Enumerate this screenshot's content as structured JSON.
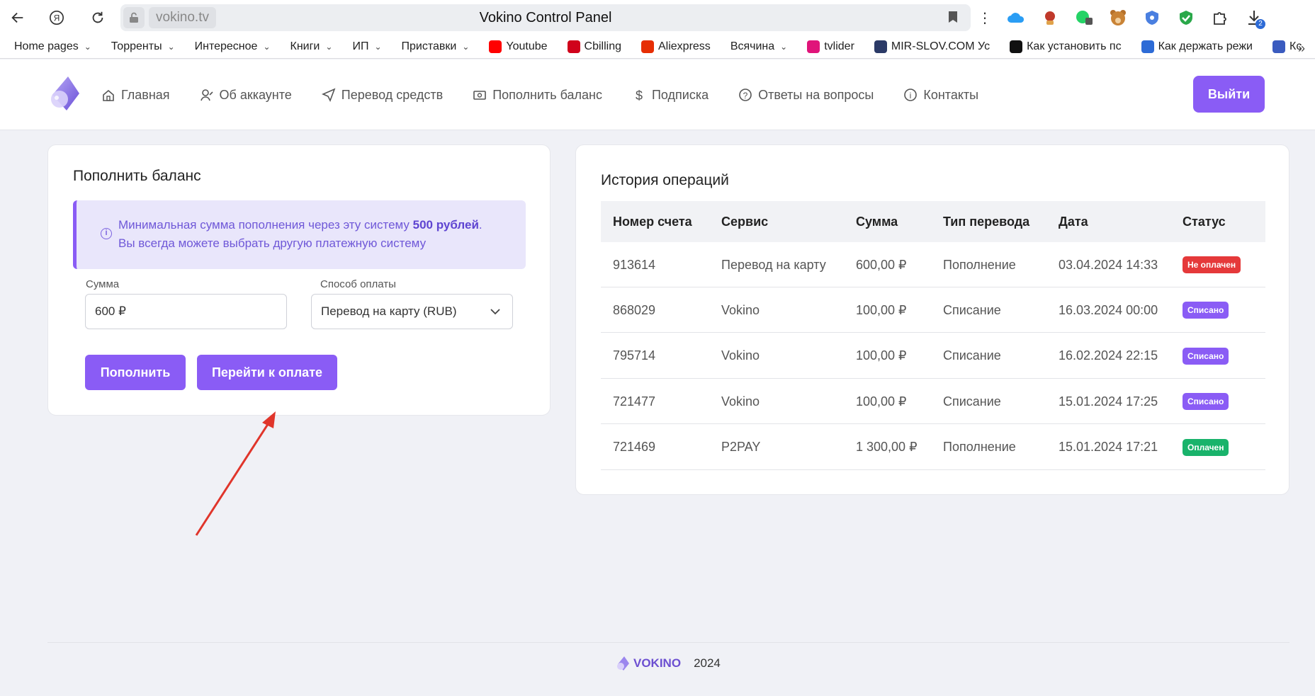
{
  "browser": {
    "domain": "vokino.tv",
    "tab_title": "Vokino Control Panel",
    "download_count": "2"
  },
  "bookmarks": [
    {
      "label": "Home pages",
      "dropdown": true
    },
    {
      "label": "Торренты",
      "dropdown": true
    },
    {
      "label": "Интересное",
      "dropdown": true
    },
    {
      "label": "Книги",
      "dropdown": true
    },
    {
      "label": "ИП",
      "dropdown": true
    },
    {
      "label": "Приставки",
      "dropdown": true
    },
    {
      "label": "Youtube",
      "icon": "youtube-icon",
      "color": "#ff0000"
    },
    {
      "label": "Cbilling",
      "icon": "cbilling-icon",
      "color": "#d0021b"
    },
    {
      "label": "Aliexpress",
      "icon": "aliexpress-icon",
      "color": "#e62e04"
    },
    {
      "label": "Всячина",
      "dropdown": true
    },
    {
      "label": "tvlider",
      "icon": "tvlider-icon",
      "color": "#e0147a"
    },
    {
      "label": "MIR-SLOV.COM Ус",
      "icon": "mirslov-icon",
      "color": "#2b3a67"
    },
    {
      "label": "Как установить пс",
      "icon": "openai-icon",
      "color": "#111111"
    },
    {
      "label": "Как держать режи",
      "icon": "ip-icon",
      "color": "#2d6bd6"
    },
    {
      "label": "Кс",
      "icon": "ks-icon",
      "color": "#3a5bbf"
    }
  ],
  "nav": {
    "items": [
      {
        "label": "Главная",
        "icon": "home-icon"
      },
      {
        "label": "Об аккаунте",
        "icon": "user-icon"
      },
      {
        "label": "Перевод средств",
        "icon": "send-icon"
      },
      {
        "label": "Пополнить баланс",
        "icon": "cash-icon"
      },
      {
        "label": "Подписка",
        "icon": "dollar-icon"
      },
      {
        "label": "Ответы на вопросы",
        "icon": "question-icon"
      },
      {
        "label": "Контакты",
        "icon": "info-icon"
      }
    ],
    "logout_label": "Выйти"
  },
  "topup": {
    "title": "Пополнить баланс",
    "alert_line1_prefix": "Минимальная сумма пополнения через эту систему ",
    "alert_line1_bold": "500 рублей",
    "alert_line1_suffix": ".",
    "alert_line2": "Вы всегда можете выбрать другую платежную систему",
    "amount_label": "Сумма",
    "amount_value": "600 ₽",
    "method_label": "Способ оплаты",
    "method_value": "Перевод на карту (RUB)",
    "topup_button": "Пополнить",
    "pay_button": "Перейти к оплате"
  },
  "history": {
    "title": "История операций",
    "columns": [
      "Номер счета",
      "Сервис",
      "Сумма",
      "Тип перевода",
      "Дата",
      "Статус"
    ],
    "rows": [
      {
        "id": "913614",
        "service": "Перевод на карту",
        "amount": "600,00 ₽",
        "type": "Пополнение",
        "date": "03.04.2024 14:33",
        "status": "Не оплачен",
        "status_color": "#e5393a"
      },
      {
        "id": "868029",
        "service": "Vokino",
        "amount": "100,00 ₽",
        "type": "Списание",
        "date": "16.03.2024 00:00",
        "status": "Списано",
        "status_color": "#8a5cf5"
      },
      {
        "id": "795714",
        "service": "Vokino",
        "amount": "100,00 ₽",
        "type": "Списание",
        "date": "16.02.2024 22:15",
        "status": "Списано",
        "status_color": "#8a5cf5"
      },
      {
        "id": "721477",
        "service": "Vokino",
        "amount": "100,00 ₽",
        "type": "Списание",
        "date": "15.01.2024 17:25",
        "status": "Списано",
        "status_color": "#8a5cf5"
      },
      {
        "id": "721469",
        "service": "P2PAY",
        "amount": "1 300,00 ₽",
        "type": "Пополнение",
        "date": "15.01.2024 17:21",
        "status": "Оплачен",
        "status_color": "#19b36b"
      }
    ]
  },
  "footer": {
    "brand": "VOKINO",
    "year": "2024"
  },
  "colors": {
    "accent": "#8a5cf5",
    "annotation_arrow": "#e0352b"
  }
}
